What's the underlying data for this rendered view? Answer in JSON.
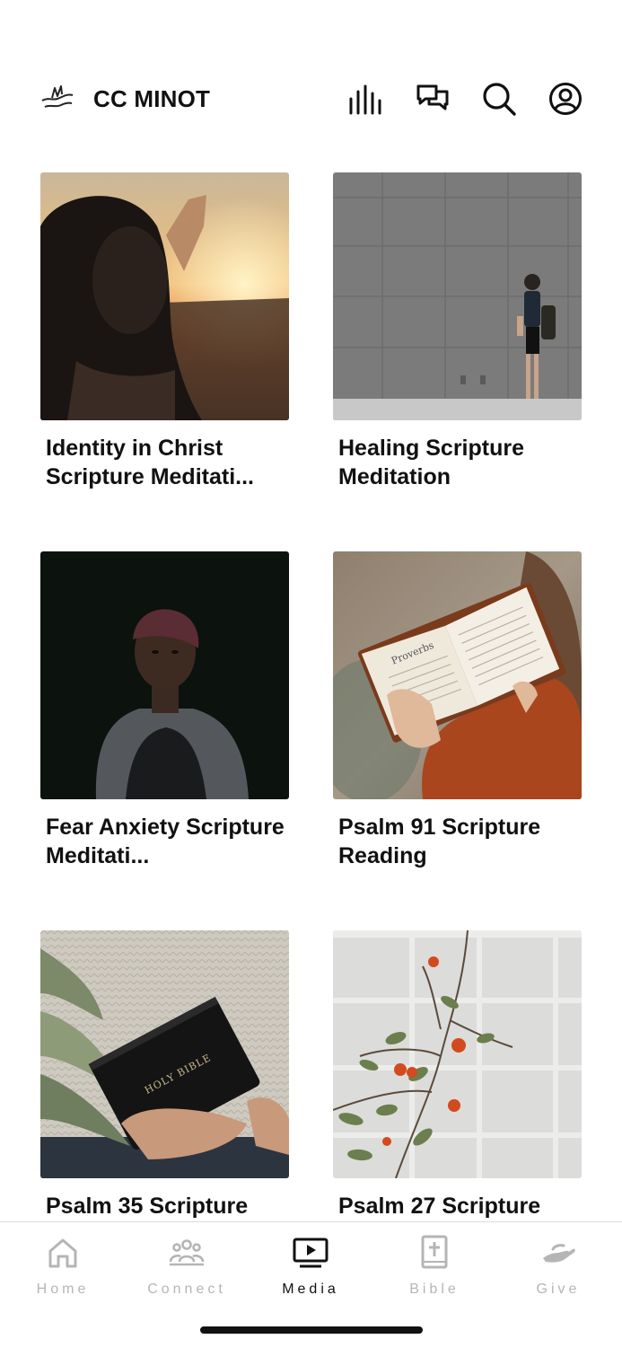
{
  "header": {
    "app_title": "CC MINOT",
    "icons": [
      "logo-icon",
      "live-audio-icon",
      "chat-icon",
      "search-icon",
      "profile-icon"
    ]
  },
  "media_items": [
    {
      "title": "Identity in Christ Scripture Meditati...",
      "image": "woman-sunset"
    },
    {
      "title": "Healing Scripture Meditation",
      "image": "man-gray-wall"
    },
    {
      "title": "Fear Anxiety Scripture Meditati...",
      "image": "woman-dark-portrait"
    },
    {
      "title": "Psalm 91 Scripture Reading",
      "image": "woman-reading-bible",
      "book_text": "Proverbs"
    },
    {
      "title": "Psalm 35 Scripture",
      "image": "holding-holy-bible",
      "book_text": "HOLY BIBLE"
    },
    {
      "title": "Psalm 27 Scripture",
      "image": "rosehip-branch"
    }
  ],
  "tabbar": {
    "tabs": [
      {
        "label": "Home",
        "icon": "home-icon",
        "active": false
      },
      {
        "label": "Connect",
        "icon": "people-icon",
        "active": false
      },
      {
        "label": "Media",
        "icon": "tv-play-icon",
        "active": true
      },
      {
        "label": "Bible",
        "icon": "bible-icon",
        "active": false
      },
      {
        "label": "Give",
        "icon": "give-hand-icon",
        "active": false
      }
    ]
  },
  "colors": {
    "active": "#111111",
    "inactive": "#b5b5b5",
    "background": "#ffffff"
  }
}
